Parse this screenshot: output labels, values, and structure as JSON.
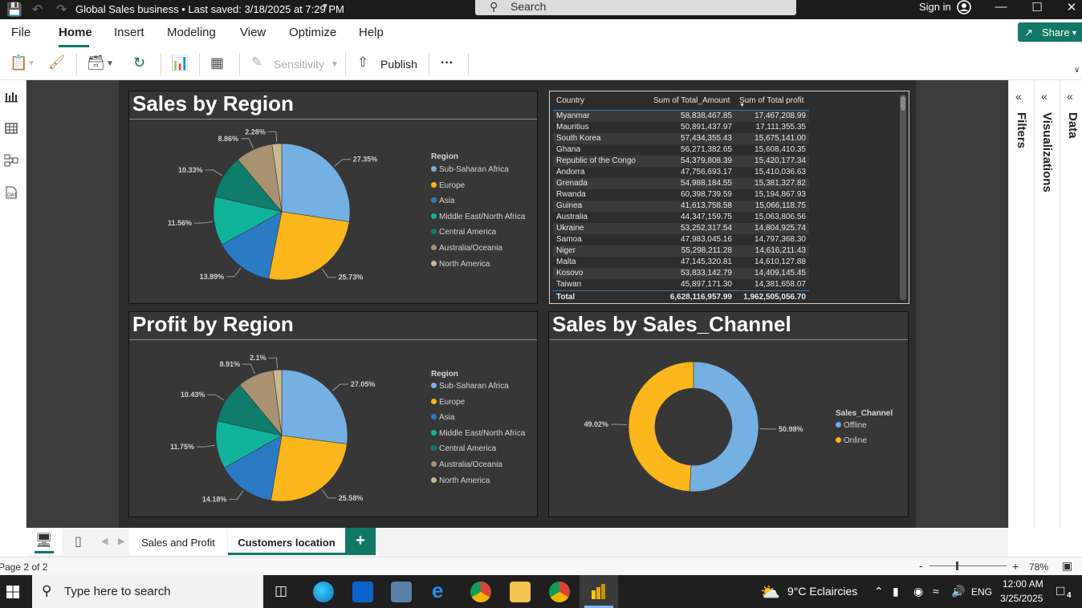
{
  "titlebar": {
    "title": "Global Sales business • Last saved: 3/18/2025 at 7:29 PM",
    "search_placeholder": "Search",
    "signin": "Sign in"
  },
  "menu": {
    "items": [
      "File",
      "Home",
      "Insert",
      "Modeling",
      "View",
      "Optimize",
      "Help"
    ],
    "share": "Share"
  },
  "ribbon": {
    "sensitivity": "Sensitivity",
    "publish": "Publish",
    "more": "···"
  },
  "panes": {
    "filters": "Filters",
    "visualizations": "Visualizations",
    "data": "Data"
  },
  "visuals": {
    "sales_region_title": "Sales by Region",
    "profit_region_title": "Profit by Region",
    "channel_title": "Sales by Sales_Channel",
    "region_legend_title": "Region",
    "channel_legend_title": "Sales_Channel"
  },
  "chart_data": [
    {
      "type": "pie",
      "title": "Sales by Region",
      "legend_title": "Region",
      "categories": [
        "Sub-Saharan Africa",
        "Europe",
        "Asia",
        "Middle East/North Africa",
        "Central America",
        "Australia/Oceania",
        "North America"
      ],
      "values": [
        27.35,
        25.73,
        13.89,
        11.56,
        10.33,
        8.86,
        2.28
      ],
      "labels": [
        "27.35%",
        "25.73%",
        "13.89%",
        "11.56%",
        "10.33%",
        "8.86%",
        "2.28%"
      ],
      "colors": [
        "#74b0e2",
        "#fbb61b",
        "#2b7ac4",
        "#10b49a",
        "#0e7d6b",
        "#a89272",
        "#c9b98f"
      ]
    },
    {
      "type": "pie",
      "title": "Profit by Region",
      "legend_title": "Region",
      "categories": [
        "Sub-Saharan Africa",
        "Europe",
        "Asia",
        "Middle East/North Africa",
        "Central America",
        "Australia/Oceania",
        "North America"
      ],
      "values": [
        27.05,
        25.58,
        14.18,
        11.75,
        10.43,
        8.91,
        2.1
      ],
      "labels": [
        "27.05%",
        "25.58%",
        "14.18%",
        "11.75%",
        "10.43%",
        "8.91%",
        "2.1%"
      ],
      "colors": [
        "#74b0e2",
        "#fbb61b",
        "#2b7ac4",
        "#10b49a",
        "#0e7d6b",
        "#a89272",
        "#c9b98f"
      ]
    },
    {
      "type": "pie",
      "title": "Sales by Sales_Channel",
      "legend_title": "Sales_Channel",
      "categories": [
        "Offline",
        "Online"
      ],
      "values": [
        50.98,
        49.02
      ],
      "labels": [
        "50.98%",
        "49.02%"
      ],
      "colors": [
        "#74b0e2",
        "#fbb61b"
      ]
    },
    {
      "type": "table",
      "columns": [
        "Country",
        "Sum of Total_Amount",
        "Sum of Total profit"
      ],
      "rows": [
        [
          "Myanmar",
          "58,838,467.85",
          "17,467,208.99"
        ],
        [
          "Mauritius",
          "50,891,437.97",
          "17,111,355.35"
        ],
        [
          "South Korea",
          "57,434,355.43",
          "15,675,141.00"
        ],
        [
          "Ghana",
          "56,271,382.65",
          "15,608,410.35"
        ],
        [
          "Republic of the Congo",
          "54,379,808.39",
          "15,420,177.34"
        ],
        [
          "Andorra",
          "47,756,693.17",
          "15,410,036.63"
        ],
        [
          "Grenada",
          "54,988,184.55",
          "15,381,327.82"
        ],
        [
          "Rwanda",
          "60,398,739.59",
          "15,194,867.93"
        ],
        [
          "Guinea",
          "41,613,758.58",
          "15,066,118.75"
        ],
        [
          "Australia",
          "44,347,159.75",
          "15,063,806.56"
        ],
        [
          "Ukraine",
          "53,252,317.54",
          "14,804,925.74"
        ],
        [
          "Samoa",
          "47,983,045.16",
          "14,797,368.30"
        ],
        [
          "Niger",
          "55,298,211.28",
          "14,616,211.43"
        ],
        [
          "Malta",
          "47,145,320.81",
          "14,610,127.88"
        ],
        [
          "Kosovo",
          "53,833,142.79",
          "14,409,145.45"
        ],
        [
          "Taiwan",
          "45,897,171.30",
          "14,381,658.07"
        ]
      ],
      "total": [
        "Total",
        "6,628,116,957.99",
        "1,962,505,056.70"
      ]
    }
  ],
  "tabs": [
    "Sales and Profit",
    "Customers location"
  ],
  "status": {
    "page": "Page 2 of 2",
    "zoom": "78%"
  },
  "taskbar": {
    "search_placeholder": "Type here to search",
    "weather": "9°C  Eclaircies",
    "lang": "ENG",
    "time": "12:00 AM",
    "date": "3/25/2025",
    "notifications": "4"
  }
}
